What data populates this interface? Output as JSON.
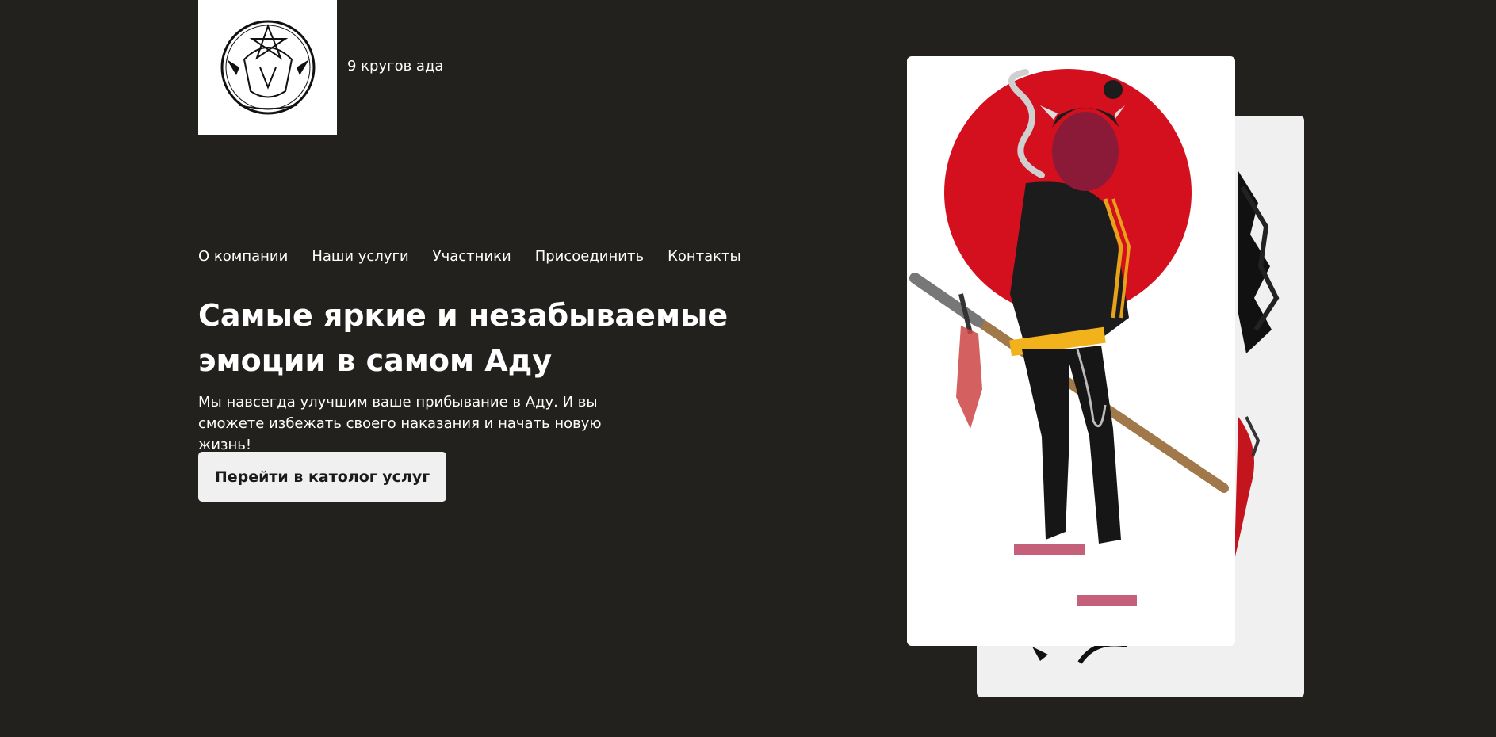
{
  "header": {
    "brand_name": "9 кругов ада",
    "logo_icon": "pentagram-circle-logo-icon"
  },
  "nav": {
    "items": [
      {
        "label": "О компании"
      },
      {
        "label": "Наши услуги"
      },
      {
        "label": "Участники"
      },
      {
        "label": "Присоединить"
      },
      {
        "label": "Контакты"
      }
    ]
  },
  "hero": {
    "title": "Самые яркие и незабываемые эмоции в самом Аду",
    "text": "Мы навсегда улучшим ваше прибывание в Аду. И вы сможете избежать своего наказания и начать новую жизнь!",
    "cta_label": "Перейти в католог услуг"
  },
  "images": {
    "front": "demon-samurai-illustration",
    "back": "winged-creature-illustration"
  },
  "colors": {
    "background": "#23211e",
    "text": "#ffffff",
    "button_bg": "#f0f0f0",
    "accent_red": "#d4101e"
  }
}
